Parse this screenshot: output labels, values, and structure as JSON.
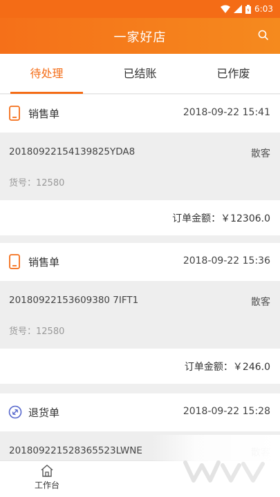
{
  "status_bar": {
    "time": "6:03"
  },
  "app_bar": {
    "title": "一家好店"
  },
  "tabs": [
    {
      "label": "待处理",
      "active": true
    },
    {
      "label": "已结账",
      "active": false
    },
    {
      "label": "已作废",
      "active": false
    }
  ],
  "orders": [
    {
      "type": "销售单",
      "icon": "phone-icon",
      "time": "2018-09-22 15:41",
      "order_no": "20180922154139825YDA8",
      "customer": "散客",
      "sku_label": "货号：12580",
      "amount_label": "订单金额：￥12306.0"
    },
    {
      "type": "销售单",
      "icon": "phone-icon",
      "time": "2018-09-22 15:36",
      "order_no": "20180922153609380 7IFT1",
      "customer": "散客",
      "sku_label": "货号：12580",
      "amount_label": "订单金额：￥246.0"
    },
    {
      "type": "退货单",
      "icon": "return-icon",
      "time": "2018-09-22 15:28",
      "order_no": "201809221528365523LWNE",
      "customer": "散客"
    }
  ],
  "bottom_nav": {
    "label": "工作台"
  },
  "colors": {
    "accent": "#f46c16",
    "background": "#efefef"
  }
}
